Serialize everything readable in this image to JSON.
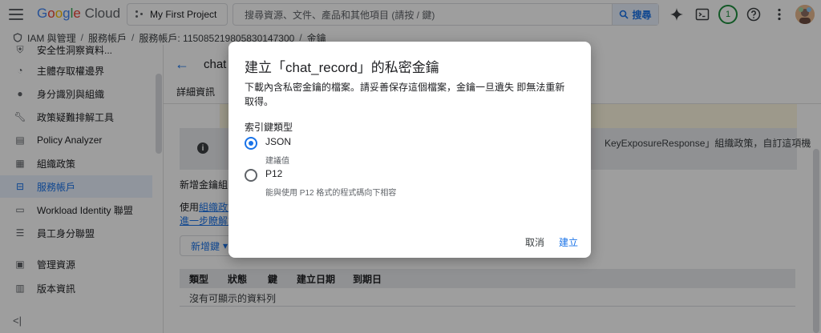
{
  "topbar": {
    "logo": {
      "g1": "G",
      "g2": "o",
      "g3": "o",
      "g1b": "g",
      "g4": "l",
      "g2b": "e",
      "cloud": " Cloud"
    },
    "project": "My First Project",
    "search_placeholder": "搜尋資源、文件、產品和其他項目 (請按 / 鍵)",
    "search_button": "搜尋",
    "notification_count": "1"
  },
  "breadcrumb": [
    "IAM 與管理",
    "服務帳戶",
    "服務帳戶: 115085219805830147300",
    "金鑰"
  ],
  "sidebar": {
    "items": [
      {
        "label": "安全性洞察資料...",
        "icon": "shield-icon"
      },
      {
        "label": "主體存取權邊界",
        "icon": "boundary-icon"
      },
      {
        "label": "身分識別與組織",
        "icon": "person-icon"
      },
      {
        "label": "政策疑難排解工具",
        "icon": "wrench-icon"
      },
      {
        "label": "Policy Analyzer",
        "icon": "analyzer-icon"
      },
      {
        "label": "組織政策",
        "icon": "document-icon"
      },
      {
        "label": "服務帳戶",
        "icon": "service-account-icon"
      },
      {
        "label": "Workload Identity 聯盟",
        "icon": "id-card-icon"
      },
      {
        "label": "員工身分聯盟",
        "icon": "list-icon"
      },
      {
        "label": "管理資源",
        "icon": "folder-icon"
      },
      {
        "label": "版本資訊",
        "icon": "notes-icon"
      }
    ],
    "active_index": 6
  },
  "main": {
    "title": "chat",
    "tab": "詳細資訊",
    "info_text": "KeyExposureResponse」組織政策，自訂這項機",
    "add_key_group_label": "新增金鑰組",
    "use_prefix": "使用",
    "use_link": "組織政策",
    "learn_more_link": "進一步瞭解如",
    "add_key_button": "新增鍵",
    "table_headers": [
      "類型",
      "狀態",
      "鍵",
      "建立日期",
      "到期日"
    ],
    "empty_message": "沒有可顯示的資料列"
  },
  "dialog": {
    "title": "建立「chat_record」的私密金鑰",
    "description": "下載內含私密金鑰的檔案。請妥善保存這個檔案，金鑰一旦遺失 即無法重新取得。",
    "section_label": "索引鍵類型",
    "options": [
      {
        "label": "JSON",
        "sublabel": "建議值",
        "checked": true
      },
      {
        "label": "P12",
        "sublabel": "能與使用 P12 格式的程式碼向下相容",
        "checked": false
      }
    ],
    "cancel": "取消",
    "create": "建立"
  }
}
